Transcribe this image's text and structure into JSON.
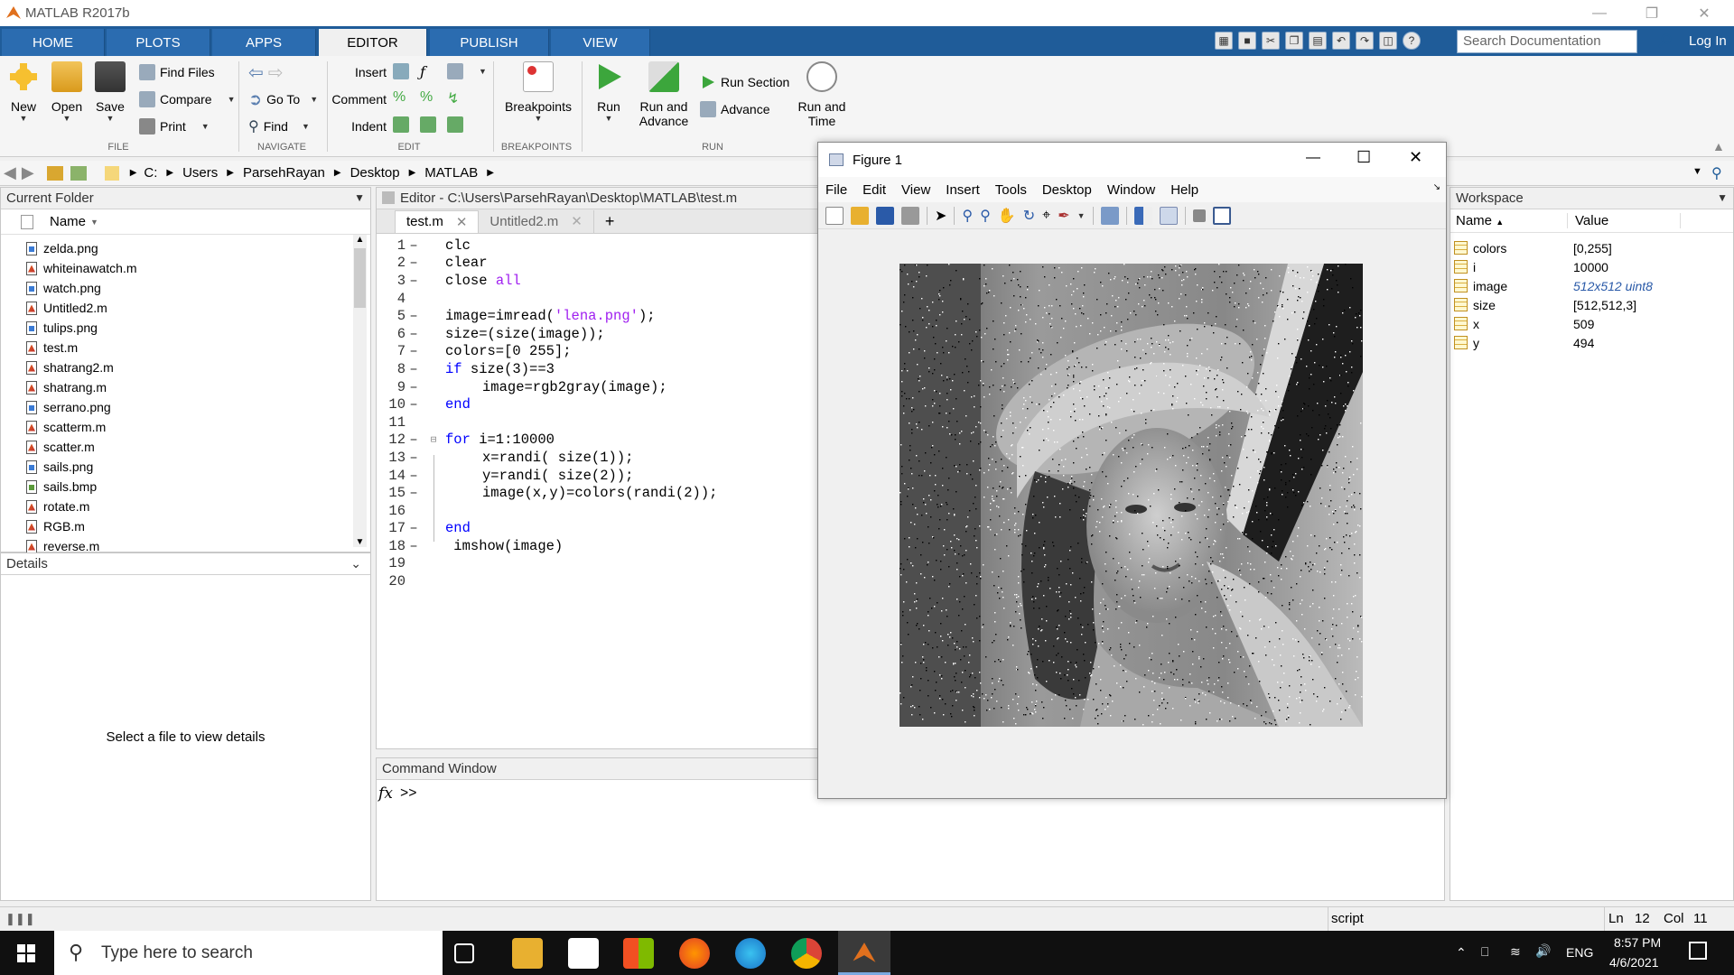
{
  "window": {
    "title": "MATLAB R2017b"
  },
  "tabs": [
    "HOME",
    "PLOTS",
    "APPS",
    "EDITOR",
    "PUBLISH",
    "VIEW"
  ],
  "active_tab": "EDITOR",
  "search": {
    "placeholder": "Search Documentation"
  },
  "login_label": "Log In",
  "ribbon": {
    "file": {
      "label": "FILE",
      "new": "New",
      "open": "Open",
      "save": "Save",
      "find_files": "Find Files",
      "compare": "Compare",
      "print": "Print"
    },
    "navigate": {
      "label": "NAVIGATE",
      "go_to": "Go To",
      "find": "Find"
    },
    "edit": {
      "label": "EDIT",
      "insert": "Insert",
      "comment": "Comment",
      "indent": "Indent"
    },
    "breakpoints": {
      "label": "BREAKPOINTS",
      "breakpoints": "Breakpoints"
    },
    "run": {
      "label": "RUN",
      "run": "Run",
      "run_and_advance_1": "Run and",
      "run_and_advance_2": "Advance",
      "run_section": "Run Section",
      "advance": "Advance",
      "run_and_time_1": "Run and",
      "run_and_time_2": "Time"
    }
  },
  "address": {
    "crumbs": [
      "C:",
      "Users",
      "ParsehRayan",
      "Desktop",
      "MATLAB"
    ]
  },
  "current_folder": {
    "title": "Current Folder",
    "column": "Name",
    "files": [
      {
        "name": "zelda.png",
        "type": "png"
      },
      {
        "name": "whiteinawatch.m",
        "type": "m"
      },
      {
        "name": "watch.png",
        "type": "png"
      },
      {
        "name": "Untitled2.m",
        "type": "m"
      },
      {
        "name": "tulips.png",
        "type": "png"
      },
      {
        "name": "test.m",
        "type": "m"
      },
      {
        "name": "shatrang2.m",
        "type": "m"
      },
      {
        "name": "shatrang.m",
        "type": "m"
      },
      {
        "name": "serrano.png",
        "type": "png"
      },
      {
        "name": "scatterm.m",
        "type": "m"
      },
      {
        "name": "scatter.m",
        "type": "m"
      },
      {
        "name": "sails.png",
        "type": "png"
      },
      {
        "name": "sails.bmp",
        "type": "bmp"
      },
      {
        "name": "rotate.m",
        "type": "m"
      },
      {
        "name": "RGB.m",
        "type": "m"
      },
      {
        "name": "reverse.m",
        "type": "m"
      }
    ]
  },
  "details": {
    "title": "Details",
    "empty_message": "Select a file to view details"
  },
  "editor": {
    "title": "Editor - C:\\Users\\ParsehRayan\\Desktop\\MATLAB\\test.m",
    "tabs": [
      "test.m",
      "Untitled2.m"
    ],
    "add_tab": "+",
    "line_numbers": [
      "1",
      "2",
      "3",
      "4",
      "5",
      "6",
      "7",
      "8",
      "9",
      "10",
      "11",
      "12",
      "13",
      "14",
      "15",
      "16",
      "17",
      "18",
      "19",
      "20"
    ],
    "code": [
      {
        "indent": 0,
        "parts": [
          [
            "n",
            "clc"
          ]
        ]
      },
      {
        "indent": 0,
        "parts": [
          [
            "n",
            "clear"
          ]
        ]
      },
      {
        "indent": 0,
        "parts": [
          [
            "n",
            "close "
          ],
          [
            "s",
            "all"
          ]
        ]
      },
      {
        "indent": 0,
        "parts": []
      },
      {
        "indent": 0,
        "parts": [
          [
            "n",
            "image=imread("
          ],
          [
            "s",
            "'lena.png'"
          ],
          [
            "n",
            ");"
          ]
        ]
      },
      {
        "indent": 0,
        "parts": [
          [
            "n",
            "size=(size(image));"
          ]
        ]
      },
      {
        "indent": 0,
        "parts": [
          [
            "n",
            "colors=[0 255];"
          ]
        ]
      },
      {
        "indent": 0,
        "parts": [
          [
            "k",
            "if"
          ],
          [
            "n",
            " size(3)==3"
          ]
        ]
      },
      {
        "indent": 1,
        "parts": [
          [
            "n",
            "image=rgb2gray(image);"
          ]
        ]
      },
      {
        "indent": 0,
        "parts": [
          [
            "k",
            "end"
          ]
        ]
      },
      {
        "indent": 0,
        "parts": []
      },
      {
        "indent": 0,
        "parts": [
          [
            "k",
            "for"
          ],
          [
            "n",
            " i=1:10000"
          ]
        ]
      },
      {
        "indent": 1,
        "parts": [
          [
            "n",
            "x=randi( size(1));"
          ]
        ]
      },
      {
        "indent": 1,
        "parts": [
          [
            "n",
            "y=randi( size(2));"
          ]
        ]
      },
      {
        "indent": 1,
        "parts": [
          [
            "n",
            "image(x,y)=colors(randi(2));"
          ]
        ]
      },
      {
        "indent": 0,
        "parts": []
      },
      {
        "indent": 0,
        "parts": [
          [
            "k",
            "end"
          ]
        ]
      },
      {
        "indent": 0,
        "parts": [
          [
            "n",
            " imshow(image)"
          ]
        ]
      },
      {
        "indent": 0,
        "parts": []
      },
      {
        "indent": 0,
        "parts": []
      }
    ]
  },
  "command_window": {
    "title": "Command Window",
    "fx": "fx",
    "prompt": ">>"
  },
  "figure": {
    "title": "Figure 1",
    "menus": [
      "File",
      "Edit",
      "View",
      "Insert",
      "Tools",
      "Desktop",
      "Window",
      "Help"
    ]
  },
  "workspace": {
    "title": "Workspace",
    "col_name": "Name",
    "col_value": "Value",
    "vars": [
      {
        "name": "colors",
        "value": "[0,255]",
        "italic": false
      },
      {
        "name": "i",
        "value": "10000",
        "italic": false
      },
      {
        "name": "image",
        "value": "512x512 uint8",
        "italic": true
      },
      {
        "name": "size",
        "value": "[512,512,3]",
        "italic": false
      },
      {
        "name": "x",
        "value": "509",
        "italic": false
      },
      {
        "name": "y",
        "value": "494",
        "italic": false
      }
    ]
  },
  "status": {
    "mode": "script",
    "ln_label": "Ln",
    "ln": "12",
    "col_label": "Col",
    "col": "11"
  },
  "taskbar": {
    "search_placeholder": "Type here to search",
    "lang": "ENG",
    "time": "8:57 PM",
    "date": "4/6/2021"
  },
  "colors": {
    "tab_blue": "#1f5c99",
    "keyword": "#0000ff",
    "string": "#a020f0"
  }
}
